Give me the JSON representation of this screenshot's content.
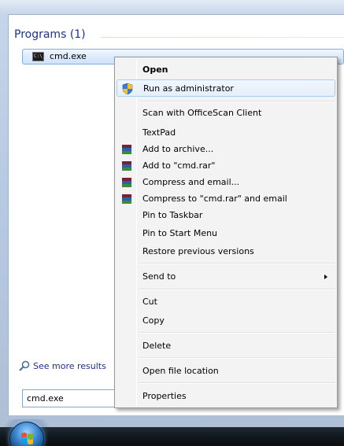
{
  "start_menu": {
    "section_header": "Programs (1)",
    "result_label": "cmd.exe",
    "result_icon": "cmd-icon",
    "see_more": "See more results",
    "search_value": "cmd.exe"
  },
  "context_menu": {
    "items": {
      "open": "Open",
      "run_as_admin": "Run as administrator",
      "scan_officescan": "Scan with OfficeScan Client",
      "textpad": "TextPad",
      "add_to_archive": "Add to archive...",
      "add_to_rar": "Add to \"cmd.rar\"",
      "compress_email": "Compress and email...",
      "compress_rar_email": "Compress to \"cmd.rar\" and email",
      "pin_taskbar": "Pin to Taskbar",
      "pin_start": "Pin to Start Menu",
      "restore_versions": "Restore previous versions",
      "send_to": "Send to",
      "cut": "Cut",
      "copy": "Copy",
      "delete": "Delete",
      "open_location": "Open file location",
      "properties": "Properties"
    },
    "icons": {
      "run_as_admin": "uac-shield-icon",
      "archive": "winrar-icon",
      "submenu": "chevron-right-icon"
    }
  },
  "colors": {
    "header_blue": "#1e3287",
    "hover_border": "#aeccf0"
  }
}
